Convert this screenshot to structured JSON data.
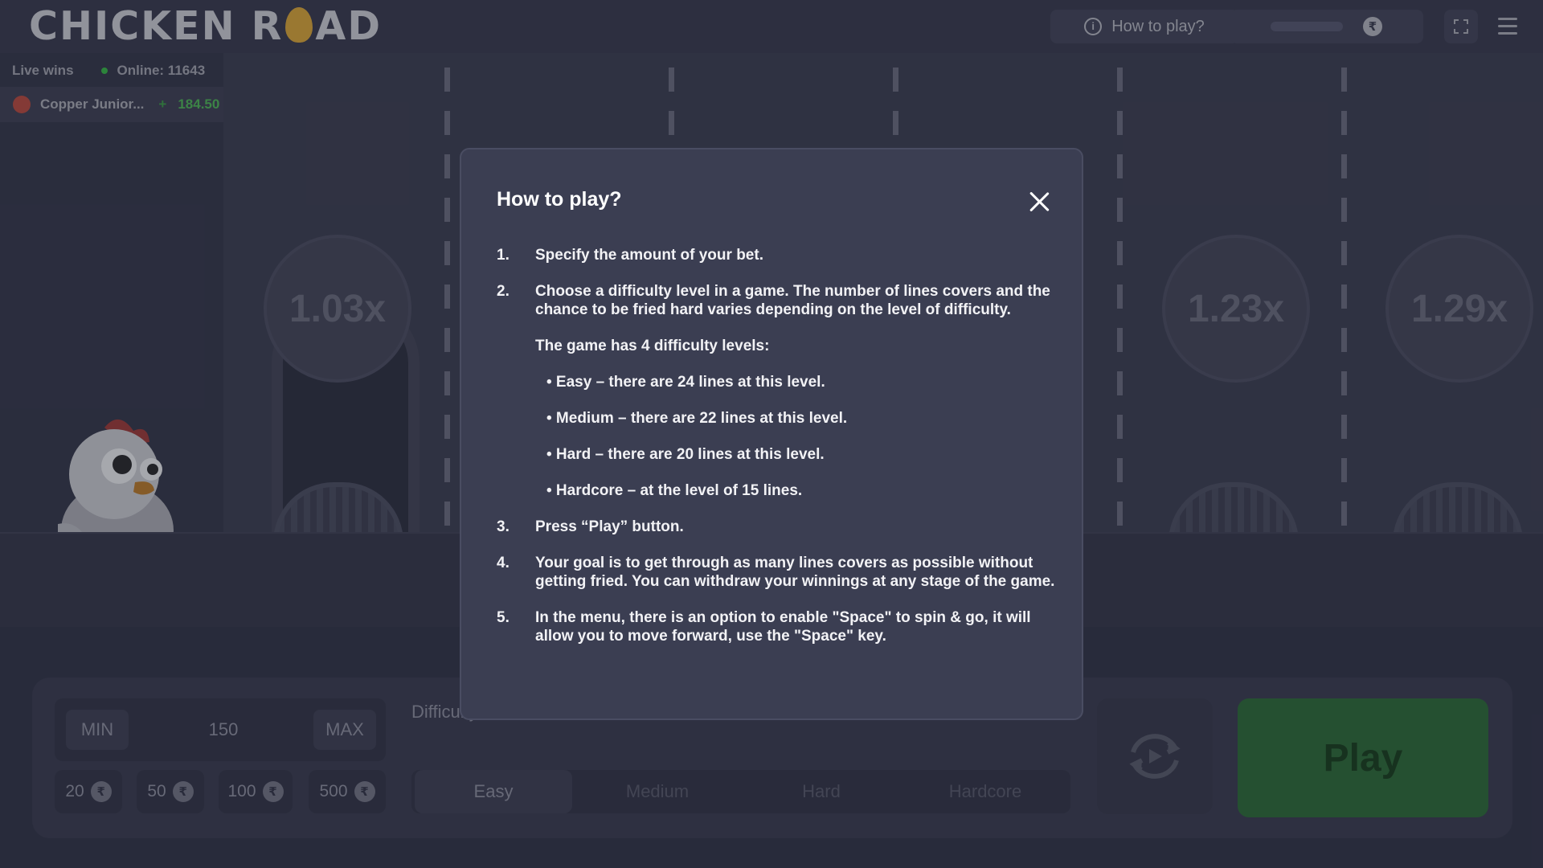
{
  "header": {
    "logo_left": "CHICKEN R",
    "logo_right": "AD",
    "how_to_play": "How to play?",
    "currency_symbol": "₹"
  },
  "live": {
    "title": "Live wins",
    "online_label": "Online: 11643",
    "entries": [
      {
        "name": "Copper Junior...",
        "sign": "+",
        "amount": "184.50"
      }
    ]
  },
  "scene": {
    "multipliers": [
      "1.03x",
      "1.23x",
      "1.29x"
    ]
  },
  "controls": {
    "min_label": "MIN",
    "max_label": "MAX",
    "bet_value": "150",
    "quick_bets": [
      "20",
      "50",
      "100",
      "500"
    ],
    "difficulty_label": "Difficulty",
    "difficulties": [
      "Easy",
      "Medium",
      "Hard",
      "Hardcore"
    ],
    "selected_difficulty": "Easy",
    "play_label": "Play"
  },
  "modal": {
    "title": "How to play?",
    "steps": [
      {
        "num": "1.",
        "text": "Specify the amount of your bet."
      },
      {
        "num": "2.",
        "text": "Choose a difficulty level in a game. The number of lines covers and the chance to be fried hard varies depending on the level of difficulty.",
        "subtitle": "The game has 4 difficulty levels:",
        "bullets": [
          "• Easy – there are 24 lines at this level.",
          "• Medium – there are 22 lines at this level.",
          "• Hard – there are 20 lines at this level.",
          "• Hardcore – at the level of 15 lines."
        ]
      },
      {
        "num": "3.",
        "text": "Press  “Play” button."
      },
      {
        "num": "4.",
        "text": "Your goal is to get through as many lines covers as possible without getting fried. You can withdraw your winnings at any stage of the game."
      },
      {
        "num": "5.",
        "text": "In the menu, there is an option to enable \"Space\" to spin & go, it will allow you to move forward, use the \"Space\" key."
      }
    ]
  },
  "colors": {
    "background": "#3b3d52",
    "modal_bg": "#3b3e52",
    "play_green": "#2f6a3c",
    "win_green": "#4fb35a"
  },
  "icons": [
    "info-icon",
    "rupee-coin-icon",
    "fullscreen-icon",
    "menu-icon",
    "close-icon",
    "auto-play-icon",
    "chicken-icon"
  ]
}
